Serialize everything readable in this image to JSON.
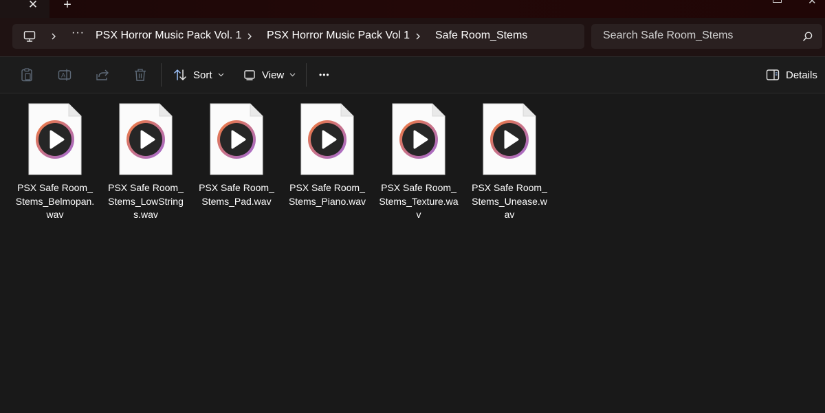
{
  "window": {
    "close_tab_glyph": "✕",
    "new_tab_glyph": "+"
  },
  "breadcrumb": {
    "overflow_glyph": "···",
    "items": [
      {
        "label": "PSX Horror Music Pack Vol. 1"
      },
      {
        "label": "PSX Horror Music Pack Vol 1"
      },
      {
        "label": "Safe Room_Stems"
      }
    ]
  },
  "search": {
    "placeholder": "Search Safe Room_Stems"
  },
  "toolbar": {
    "sort_label": "Sort",
    "view_label": "View",
    "more_glyph": "•••",
    "details_label": "Details"
  },
  "files": [
    {
      "name": "PSX Safe Room_Stems_Belmopan.wav",
      "icon": "media-play-icon"
    },
    {
      "name": "PSX Safe Room_Stems_LowStrings.wav",
      "icon": "media-play-icon"
    },
    {
      "name": "PSX Safe Room_Stems_Pad.wav",
      "icon": "media-play-icon"
    },
    {
      "name": "PSX Safe Room_Stems_Piano.wav",
      "icon": "media-play-icon"
    },
    {
      "name": "PSX Safe Room_Stems_Texture.wav",
      "icon": "media-play-icon"
    },
    {
      "name": "PSX Safe Room_Stems_Unease.wav",
      "icon": "media-play-icon"
    }
  ],
  "colors": {
    "title_bar": "#230808",
    "background": "#191919",
    "accent_orange": "#f07a3a",
    "accent_purple": "#a06ad8"
  }
}
